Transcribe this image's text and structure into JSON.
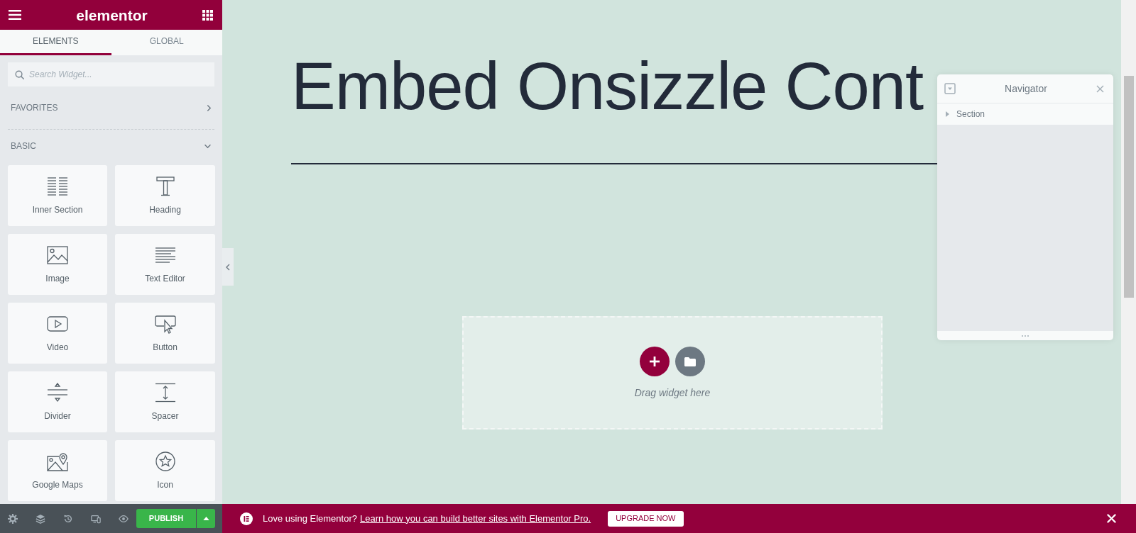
{
  "panel": {
    "logo": "elementor",
    "tabs": [
      {
        "label": "ELEMENTS",
        "selected": true
      },
      {
        "label": "GLOBAL",
        "selected": false
      }
    ],
    "search": {
      "placeholder": "Search Widget..."
    },
    "categories": [
      {
        "label": "FAVORITES",
        "expanded": false
      },
      {
        "label": "BASIC",
        "expanded": true,
        "widgets": [
          "Inner Section",
          "Heading",
          "Image",
          "Text Editor",
          "Video",
          "Button",
          "Divider",
          "Spacer",
          "Google Maps",
          "Icon"
        ]
      }
    ]
  },
  "panel_footer": {
    "publish_button": "PUBLISH"
  },
  "canvas": {
    "heading": "Embed Onsizzle Cont",
    "drop_zone": {
      "hint": "Drag widget here"
    }
  },
  "navigator": {
    "title": "Navigator",
    "items": [
      {
        "label": "Section",
        "expanded": false
      }
    ]
  },
  "promo_bar": {
    "text": "Love using Elementor?",
    "link": "Learn how you can build better sites with Elementor Pro.",
    "button": "UPGRADE NOW"
  }
}
